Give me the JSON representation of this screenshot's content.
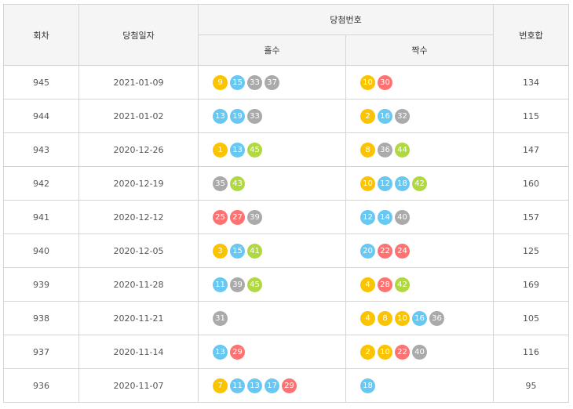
{
  "headers": {
    "round": "회차",
    "date": "당첨일자",
    "winning_numbers": "당첨번호",
    "odd": "홀수",
    "even": "짝수",
    "sum": "번호합"
  },
  "ball_colors": {
    "1-10": "#fbc400",
    "11-20": "#69c8f2",
    "21-30": "#ff7272",
    "31-40": "#aaaaaa",
    "41-45": "#b0d840"
  },
  "rows": [
    {
      "round": "945",
      "date": "2021-01-09",
      "odd": [
        9,
        15,
        33,
        37
      ],
      "even": [
        10,
        30
      ],
      "sum": "134"
    },
    {
      "round": "944",
      "date": "2021-01-02",
      "odd": [
        13,
        19,
        33
      ],
      "even": [
        2,
        16,
        32
      ],
      "sum": "115"
    },
    {
      "round": "943",
      "date": "2020-12-26",
      "odd": [
        1,
        13,
        45
      ],
      "even": [
        8,
        36,
        44
      ],
      "sum": "147"
    },
    {
      "round": "942",
      "date": "2020-12-19",
      "odd": [
        35,
        43
      ],
      "even": [
        10,
        12,
        18,
        42
      ],
      "sum": "160"
    },
    {
      "round": "941",
      "date": "2020-12-12",
      "odd": [
        25,
        27,
        39
      ],
      "even": [
        12,
        14,
        40
      ],
      "sum": "157"
    },
    {
      "round": "940",
      "date": "2020-12-05",
      "odd": [
        3,
        15,
        41
      ],
      "even": [
        20,
        22,
        24
      ],
      "sum": "125"
    },
    {
      "round": "939",
      "date": "2020-11-28",
      "odd": [
        11,
        39,
        45
      ],
      "even": [
        4,
        28,
        42
      ],
      "sum": "169"
    },
    {
      "round": "938",
      "date": "2020-11-21",
      "odd": [
        31
      ],
      "even": [
        4,
        8,
        10,
        16,
        36
      ],
      "sum": "105"
    },
    {
      "round": "937",
      "date": "2020-11-14",
      "odd": [
        13,
        29
      ],
      "even": [
        2,
        10,
        22,
        40
      ],
      "sum": "116"
    },
    {
      "round": "936",
      "date": "2020-11-07",
      "odd": [
        7,
        11,
        13,
        17,
        29
      ],
      "even": [
        18
      ],
      "sum": "95"
    }
  ]
}
